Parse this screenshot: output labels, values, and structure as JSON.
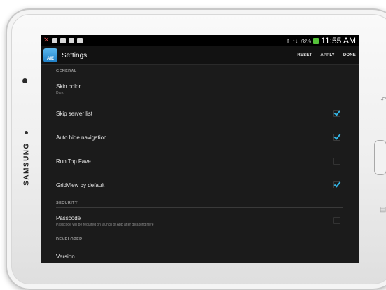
{
  "device": {
    "brand": "SAMSUNG"
  },
  "statusbar": {
    "signal": "↑↓",
    "battery_percent": "78%",
    "time": "11:55 AM"
  },
  "actionbar": {
    "app_icon_text": "AIE",
    "title": "Settings",
    "reset_label": "RESET",
    "apply_label": "APPLY",
    "done_label": "DONE"
  },
  "sections": {
    "general": "GENERAL",
    "security": "SECURITY",
    "developer": "DEVELOPER"
  },
  "settings": {
    "skin_color": {
      "title": "Skin color",
      "value": "Dark"
    },
    "skip_server_list": {
      "title": "Skip server list",
      "checked": true
    },
    "auto_hide_navigation": {
      "title": "Auto hide navigation",
      "checked": true
    },
    "run_top_fave": {
      "title": "Run Top Fave",
      "checked": false
    },
    "gridview_by_default": {
      "title": "GridView by default",
      "checked": true
    },
    "passcode": {
      "title": "Passcode",
      "subtitle": "Passcode will be required on launch of App after disabling here",
      "checked": false
    },
    "version": {
      "title": "Version"
    }
  },
  "colors": {
    "accent": "#33b5e5",
    "background": "#1b1b1b",
    "battery": "#55c23a"
  }
}
